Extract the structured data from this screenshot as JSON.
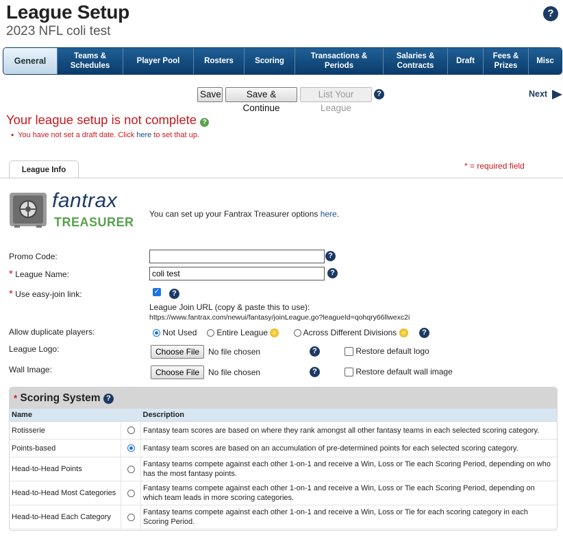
{
  "header": {
    "title": "League Setup",
    "subtitle": "2023 NFL coli test",
    "help": "?"
  },
  "tabs": [
    {
      "label": "General",
      "active": true
    },
    {
      "label": "Teams & Schedules"
    },
    {
      "label": "Player Pool"
    },
    {
      "label": "Rosters"
    },
    {
      "label": "Scoring"
    },
    {
      "label": "Transactions & Periods"
    },
    {
      "label": "Salaries & Contracts"
    },
    {
      "label": "Draft"
    },
    {
      "label": "Fees & Prizes"
    },
    {
      "label": "Misc"
    }
  ],
  "actions": {
    "save": "Save",
    "save_continue": "Save & Continue",
    "list_league": "List Your League",
    "next": "Next"
  },
  "warning": {
    "title": "Your league setup is not complete",
    "item_prefix": "You have not set a draft date. Click ",
    "item_link": "here",
    "item_suffix": " to set that up."
  },
  "required_note": "* = required field",
  "info_tab": "League Info",
  "treasurer": {
    "logo_top": "fantrax",
    "logo_bottom": "TREASURER",
    "text": "You can set up your Fantrax Treasurer options ",
    "link": "here",
    "end": "."
  },
  "form": {
    "promo_label": "Promo Code:",
    "promo_value": "",
    "name_label": "League Name:",
    "name_value": "coli test",
    "easy_join_label": "Use easy-join link:",
    "join_url_label": "League Join URL (copy & paste this to use):",
    "join_url": "https://www.fantrax.com/newui/fantasy/joinLeague.go?leagueId=qohqry66llwexc2i",
    "dup_label": "Allow duplicate players:",
    "dup_options": [
      "Not Used",
      "Entire League",
      "Across Different Divisions"
    ],
    "logo_label": "League Logo:",
    "wall_label": "Wall Image:",
    "choose_file": "Choose File",
    "no_file": "No file chosen",
    "restore_logo": "Restore default logo",
    "restore_wall": "Restore default wall image"
  },
  "scoring": {
    "title": "Scoring System",
    "col_name": "Name",
    "col_desc": "Description",
    "rows": [
      {
        "name": "Rotisserie",
        "desc": "Fantasy team scores are based on where they rank amongst all other fantasy teams in each selected scoring category."
      },
      {
        "name": "Points-based",
        "desc": "Fantasy team scores are based on an accumulation of pre-determined points for each selected scoring category."
      },
      {
        "name": "Head-to-Head Points",
        "desc": "Fantasy teams compete against each other 1-on-1 and receive a Win, Loss or Tie each Scoring Period, depending on who has the most fantasy points."
      },
      {
        "name": "Head-to-Head Most Categories",
        "desc": "Fantasy teams compete against each other 1-on-1 and receive a Win, Loss or Tie each Scoring Period, depending on which team leads in more scoring categories."
      },
      {
        "name": "Head-to-Head Each Category",
        "desc": "Fantasy teams compete against each other 1-on-1 and receive a Win, Loss or Tie for each scoring category in each Scoring Period."
      }
    ]
  }
}
